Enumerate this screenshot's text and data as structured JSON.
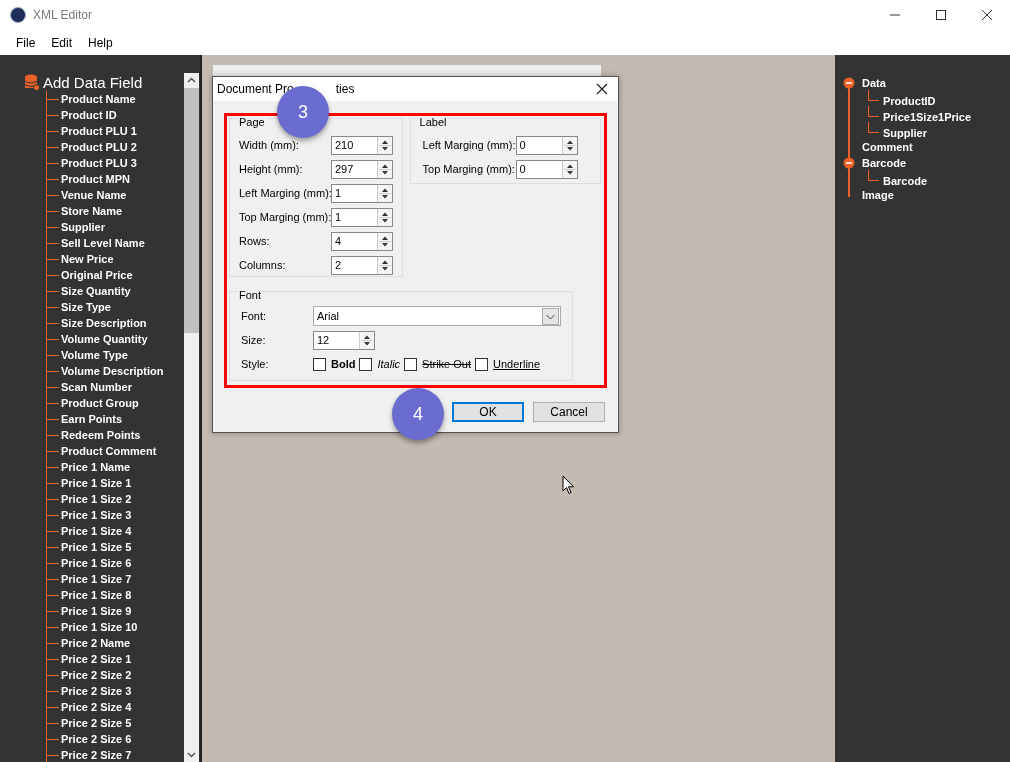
{
  "window": {
    "title": "XML Editor"
  },
  "menu": [
    "File",
    "Edit",
    "Help"
  ],
  "sidebar": {
    "title": "Add Data Field",
    "items": [
      "Product Name",
      "Product ID",
      "Product PLU 1",
      "Product PLU 2",
      "Product PLU 3",
      "Product MPN",
      "Venue Name",
      "Store Name",
      "Supplier",
      "Sell Level Name",
      "New Price",
      "Original Price",
      "Size Quantity",
      "Size Type",
      "Size Description",
      "Volume Quantity",
      "Volume Type",
      "Volume Description",
      "Scan Number",
      "Product Group",
      "Earn Points",
      "Redeem Points",
      "Product Comment",
      "Price 1 Name",
      "Price 1 Size 1",
      "Price 1 Size 2",
      "Price 1 Size 3",
      "Price 1 Size 4",
      "Price 1 Size 5",
      "Price 1 Size 6",
      "Price 1 Size 7",
      "Price 1 Size 8",
      "Price 1 Size 9",
      "Price 1 Size 10",
      "Price 2 Name",
      "Price 2 Size 1",
      "Price 2 Size 2",
      "Price 2 Size 3",
      "Price 2 Size 4",
      "Price 2 Size 5",
      "Price 2 Size 6",
      "Price 2 Size 7"
    ]
  },
  "tree": [
    {
      "label": "Data",
      "expanded": true,
      "children": [
        {
          "label": "ProductID"
        },
        {
          "label": "Price1Size1Price"
        },
        {
          "label": "Supplier"
        }
      ]
    },
    {
      "label": "Comment"
    },
    {
      "label": "Barcode",
      "expanded": true,
      "children": [
        {
          "label": "Barcode"
        }
      ]
    },
    {
      "label": "Image"
    }
  ],
  "dialog": {
    "title_parts": [
      "Document Pro",
      "ties"
    ],
    "page": {
      "title": "Page",
      "fields": [
        {
          "label": "Width (mm):",
          "value": "210"
        },
        {
          "label": "Height (mm):",
          "value": "297"
        },
        {
          "label": "Left Marging (mm):",
          "value": "1"
        },
        {
          "label": "Top Marging (mm):",
          "value": "1"
        },
        {
          "label": "Rows:",
          "value": "4"
        },
        {
          "label": "Columns:",
          "value": "2"
        }
      ]
    },
    "label": {
      "title": "Label",
      "fields": [
        {
          "label": "Left Marging (mm):",
          "value": "0"
        },
        {
          "label": "Top Marging (mm):",
          "value": "0"
        }
      ]
    },
    "font": {
      "title": "Font",
      "font_label": "Font:",
      "font_value": "Arial",
      "size_label": "Size:",
      "size_value": "12",
      "style_label": "Style:",
      "styles": [
        {
          "kind": "bold",
          "label": "Bold",
          "checked": false
        },
        {
          "kind": "italic",
          "label": "Italic",
          "checked": false
        },
        {
          "kind": "strike",
          "label": "Strike Out",
          "checked": false
        },
        {
          "kind": "underline",
          "label": "Underline",
          "checked": false
        }
      ]
    },
    "buttons": [
      {
        "label": "OK",
        "default": true
      },
      {
        "label": "Cancel",
        "default": false
      }
    ]
  },
  "callouts": [
    "3",
    "4"
  ]
}
